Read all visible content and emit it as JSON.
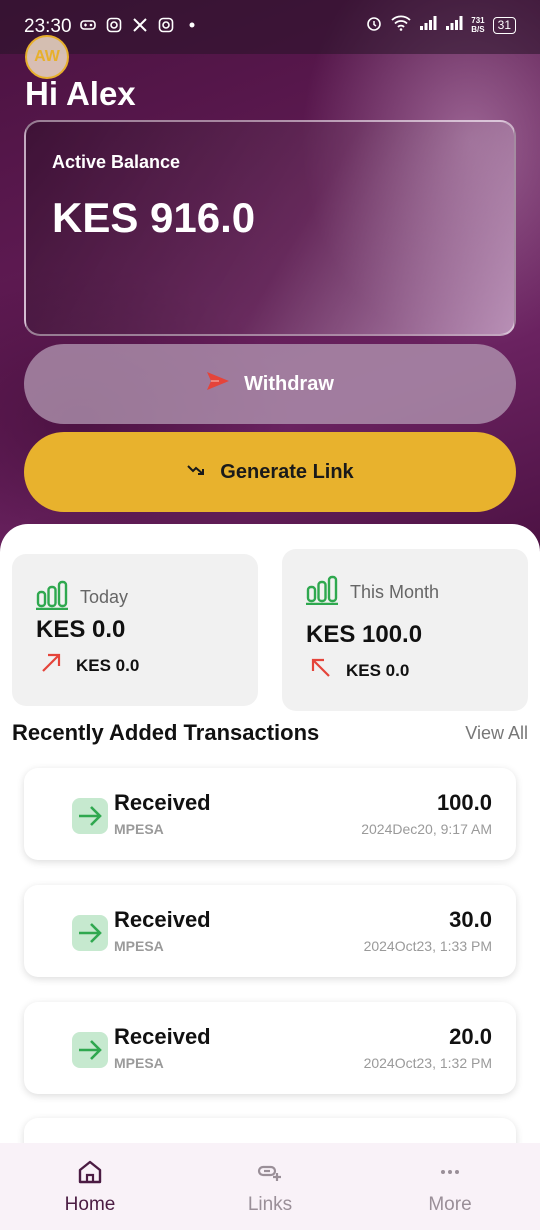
{
  "status_bar": {
    "time": "23:30",
    "net_speed_top": "731",
    "net_speed_bottom": "B/S",
    "battery": "31"
  },
  "user": {
    "initials": "AW",
    "greeting": "Hi Alex"
  },
  "balance": {
    "label": "Active Balance",
    "value": "KES 916.0"
  },
  "actions": {
    "withdraw_label": "Withdraw",
    "generate_label": "Generate Link"
  },
  "stats": {
    "today": {
      "title": "Today",
      "value": "KES 0.0",
      "change": "KES 0.0"
    },
    "month": {
      "title": "This Month",
      "value": "KES 100.0",
      "change": "KES 0.0"
    }
  },
  "transactions": {
    "title": "Recently Added Transactions",
    "view_all": "View All",
    "items": [
      {
        "type": "Received",
        "method": "MPESA",
        "amount": "100.0",
        "date": "2024Dec20, 9:17 AM"
      },
      {
        "type": "Received",
        "method": "MPESA",
        "amount": "30.0",
        "date": "2024Oct23, 1:33 PM"
      },
      {
        "type": "Received",
        "method": "MPESA",
        "amount": "20.0",
        "date": "2024Oct23, 1:32 PM"
      }
    ]
  },
  "nav": {
    "home": "Home",
    "links": "Links",
    "more": "More"
  },
  "colors": {
    "accent": "#e8b22d",
    "brand": "#5e1a52",
    "positive": "#2fa84f",
    "negative": "#e5443a"
  }
}
